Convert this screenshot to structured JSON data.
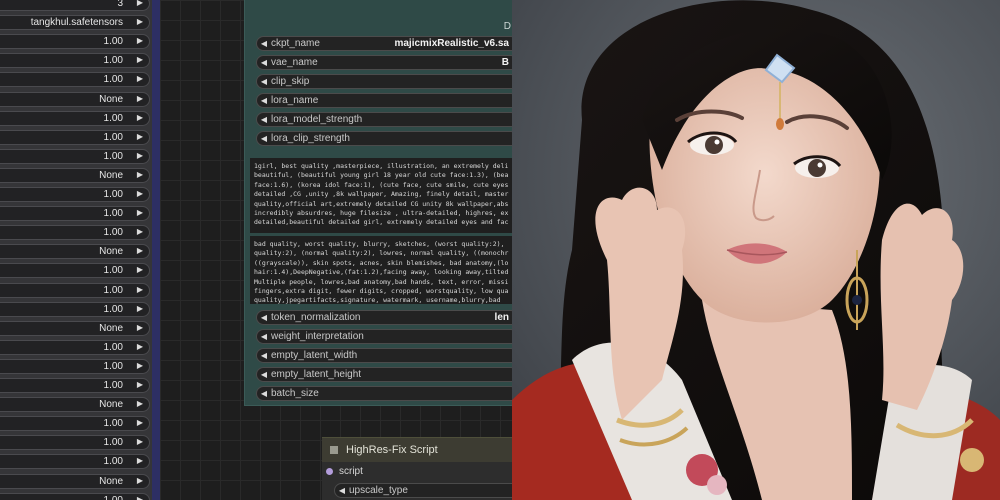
{
  "left_node": {
    "rows": [
      {
        "value": "3"
      },
      {
        "value": "tangkhul.safetensors"
      },
      {
        "value": "1.00"
      },
      {
        "value": "1.00"
      },
      {
        "value": "1.00"
      },
      {
        "value": "None"
      },
      {
        "value": "1.00"
      },
      {
        "value": "1.00"
      },
      {
        "value": "1.00"
      },
      {
        "value": "None"
      },
      {
        "value": "1.00"
      },
      {
        "value": "1.00"
      },
      {
        "value": "1.00"
      },
      {
        "value": "None"
      },
      {
        "value": "1.00"
      },
      {
        "value": "1.00"
      },
      {
        "value": "1.00"
      },
      {
        "value": "None"
      },
      {
        "value": "1.00"
      },
      {
        "value": "1.00"
      },
      {
        "value": "1.00"
      },
      {
        "value": "None"
      },
      {
        "value": "1.00"
      },
      {
        "value": "1.00"
      },
      {
        "value": "1.00"
      },
      {
        "value": "None"
      },
      {
        "value": "1.00"
      }
    ]
  },
  "main_node": {
    "tag": "D",
    "widgets_top": [
      {
        "label": "ckpt_name",
        "value": "majicmixRealistic_v6.sa"
      },
      {
        "label": "vae_name",
        "value": "B"
      },
      {
        "label": "clip_skip",
        "value": ""
      },
      {
        "label": "lora_name",
        "value": ""
      },
      {
        "label": "lora_model_strength",
        "value": ""
      },
      {
        "label": "lora_clip_strength",
        "value": ""
      }
    ],
    "positive_lines": [
      "1girl, best quality ,masterpiece, illustration, an extremely deli",
      "beautiful, (beautiful young girl 18 year old cute face:1.3), (bea",
      "face:1.6), (korea idol face:1), (cute face, cute smile, cute eyes",
      "detailed ,CG ,unity ,8k wallpaper, Amazing, finely detail, master",
      "quality,official art,extremely detailed CG unity 8k wallpaper,abs",
      "incredibly absurdres, huge filesize , ultra-detailed, highres, ex",
      "detailed,beautiful detailed girl, extremely detailed eyes and fac"
    ],
    "negative_lines": [
      "bad quality, worst quality, blurry, sketches, (worst quality:2),",
      "quality:2), (normal quality:2), lowres, normal quality, ((monochr",
      "((grayscale)), skin spots, acnes, skin blemishes, bad anatomy,(lo",
      "hair:1.4),DeepNegative,(fat:1.2),facing away, looking away,tilted",
      "Multiple people, lowres,bad anatomy,bad hands, text, error, missi",
      "fingers,extra digit, fewer digits, cropped, worstquality, low qua",
      "quality,jpegartifacts,signature, watermark, username,blurry,bad"
    ],
    "widgets_bottom": [
      {
        "label": "token_normalization",
        "value": "len"
      },
      {
        "label": "weight_interpretation",
        "value": ""
      },
      {
        "label": "empty_latent_width",
        "value": ""
      },
      {
        "label": "empty_latent_height",
        "value": ""
      },
      {
        "label": "batch_size",
        "value": ""
      }
    ]
  },
  "highres_node": {
    "title": "HighRes-Fix Script",
    "input_label": "script",
    "widget_label": "upscale_type"
  },
  "colors": {
    "canvas": "#1e1e1e",
    "node_teal": "#2f4a47",
    "node_edge_blue": "#2d2f64",
    "widget_bg": "#232323",
    "input_dot": "#b39ddb"
  }
}
